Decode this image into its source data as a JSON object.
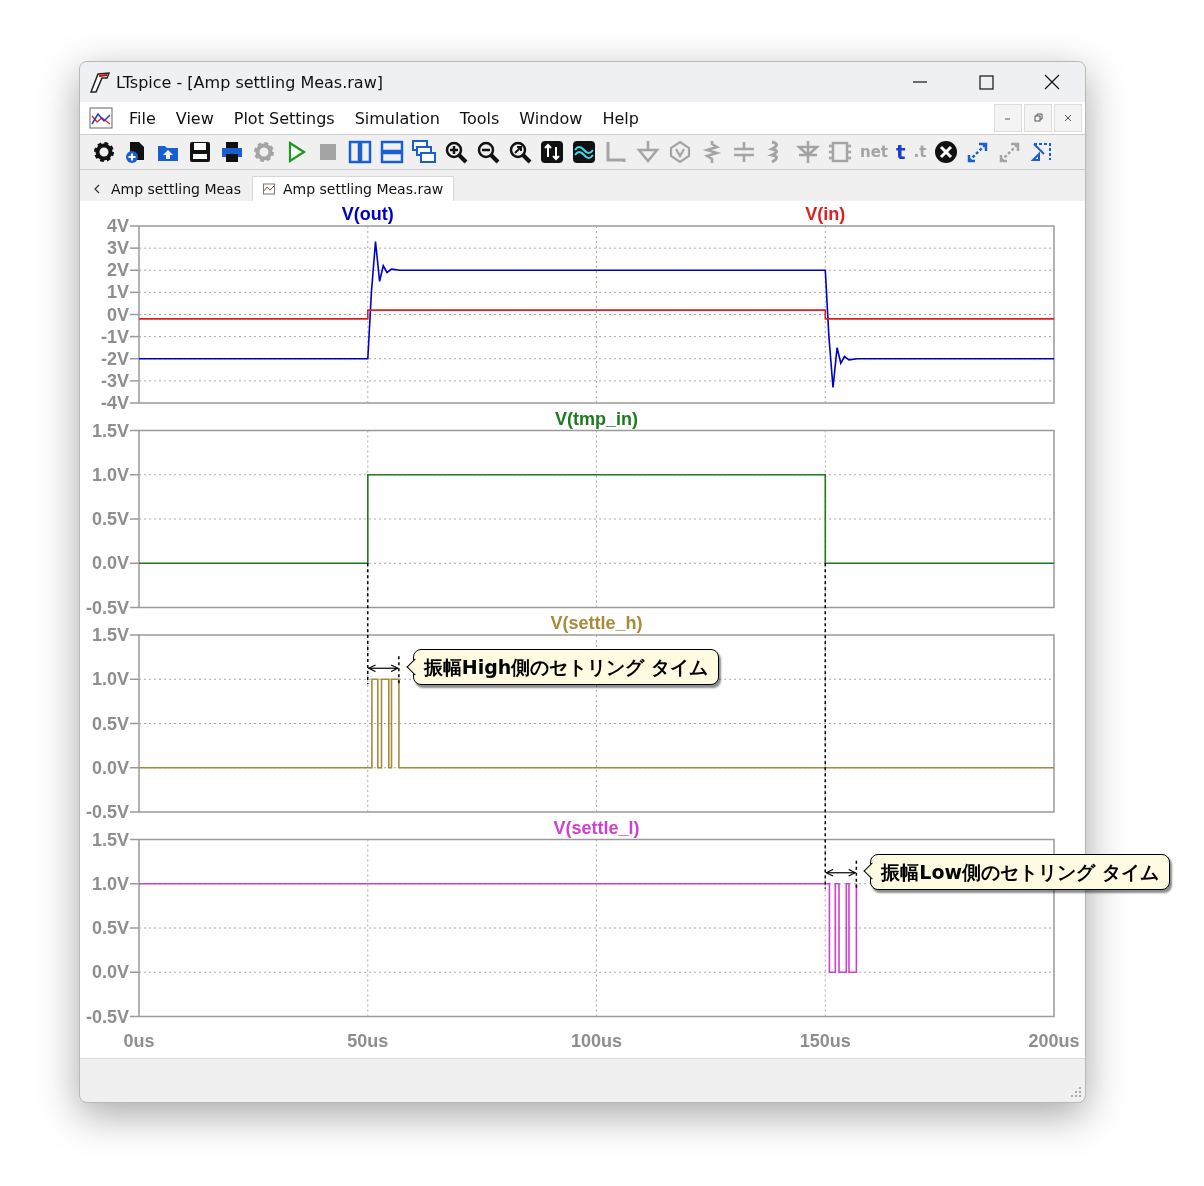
{
  "window": {
    "title": "LTspice - [Amp settling Meas.raw]"
  },
  "menu": [
    "File",
    "View",
    "Plot Settings",
    "Simulation",
    "Tools",
    "Window",
    "Help"
  ],
  "toolbar": [
    {
      "kind": "settings",
      "disabled": false
    },
    {
      "kind": "new",
      "disabled": false
    },
    {
      "kind": "open",
      "disabled": false
    },
    {
      "kind": "save",
      "disabled": false
    },
    {
      "kind": "print",
      "disabled": false
    },
    {
      "kind": "halt",
      "disabled": true
    },
    {
      "kind": "run",
      "disabled": false
    },
    {
      "kind": "stop",
      "disabled": true
    },
    {
      "kind": "tile_v",
      "disabled": false
    },
    {
      "kind": "tile_h",
      "disabled": false
    },
    {
      "kind": "cascade",
      "disabled": false
    },
    {
      "kind": "zoom_in",
      "disabled": false
    },
    {
      "kind": "zoom_out",
      "disabled": false
    },
    {
      "kind": "zoom_fit",
      "disabled": false
    },
    {
      "kind": "autorange",
      "disabled": false
    },
    {
      "kind": "wave",
      "disabled": false
    },
    {
      "kind": "wire",
      "disabled": true
    },
    {
      "kind": "ground",
      "disabled": true
    },
    {
      "kind": "node",
      "disabled": true
    },
    {
      "kind": "resistor",
      "disabled": true
    },
    {
      "kind": "capacitor",
      "disabled": true
    },
    {
      "kind": "inductor",
      "disabled": true
    },
    {
      "kind": "diode",
      "disabled": true
    },
    {
      "kind": "component",
      "disabled": true
    },
    {
      "kind": "glyph",
      "glyph": "net",
      "disabled": true
    },
    {
      "kind": "glyph",
      "glyph": "t",
      "disabled": false
    },
    {
      "kind": "glyph",
      "glyph": ".t",
      "disabled": true
    },
    {
      "kind": "delete",
      "disabled": false
    },
    {
      "kind": "duplicate",
      "disabled": false
    },
    {
      "kind": "move",
      "disabled": true
    },
    {
      "kind": "drag",
      "disabled": false
    }
  ],
  "tabs": [
    {
      "kind": "schematic",
      "label": "Amp settling Meas",
      "selected": false
    },
    {
      "kind": "waveform",
      "label": "Amp settling Meas.raw",
      "selected": true
    }
  ],
  "plot": {
    "panes": [
      {
        "chart_data": {
          "type": "line",
          "grid": true,
          "xlim": [
            0,
            200
          ],
          "ylim": [
            -4,
            4
          ],
          "x": [
            0,
            50,
            50,
            50.8,
            51.7,
            52.6,
            53.4,
            54.2,
            55.2,
            57,
            150,
            150,
            150.8,
            151.7,
            152.6,
            153.4,
            154.2,
            155.2,
            157,
            200
          ],
          "series": [
            {
              "name": "V(out)",
              "color": "#0000c8",
              "values": [
                -2,
                -2,
                -2,
                1,
                3.3,
                1.5,
                2.2,
                1.9,
                2.05,
                2,
                2,
                2,
                -1,
                -3.3,
                -1.5,
                -2.2,
                -1.9,
                -2.05,
                -2,
                -2
              ]
            },
            {
              "name": "V(in)",
              "color": "#e02020",
              "values": [
                -0.2,
                -0.2,
                0.2,
                0.2,
                0.2,
                0.2,
                0.2,
                0.2,
                0.2,
                0.2,
                0.2,
                -0.2,
                -0.2,
                -0.2,
                -0.2,
                -0.2,
                -0.2,
                -0.2,
                -0.2,
                -0.2
              ]
            }
          ],
          "yticks": [
            {
              "value": 4,
              "label": "4V"
            },
            {
              "value": 3,
              "label": "3V"
            },
            {
              "value": 2,
              "label": "2V"
            },
            {
              "value": 1,
              "label": "1V"
            },
            {
              "value": 0,
              "label": "0V"
            },
            {
              "value": -1,
              "label": "-1V"
            },
            {
              "value": -2,
              "label": "-2V"
            },
            {
              "value": -3,
              "label": "-3V"
            },
            {
              "value": -4,
              "label": "-4V"
            }
          ]
        }
      },
      {
        "chart_data": {
          "type": "line",
          "grid": true,
          "xlim": [
            0,
            200
          ],
          "ylim": [
            -0.5,
            1.5
          ],
          "x": [
            0,
            50,
            50,
            150,
            150,
            200
          ],
          "series": [
            {
              "name": "V(tmp_in)",
              "color": "#1e7a1e",
              "values": [
                0,
                0,
                1,
                1,
                0,
                0
              ]
            }
          ],
          "yticks": [
            {
              "value": 1.5,
              "label": "1.5V"
            },
            {
              "value": 1,
              "label": "1.0V"
            },
            {
              "value": 0.5,
              "label": "0.5V"
            },
            {
              "value": 0,
              "label": "0.0V"
            },
            {
              "value": -0.5,
              "label": "-0.5V"
            }
          ]
        }
      },
      {
        "chart_data": {
          "type": "line",
          "grid": true,
          "xlim": [
            0,
            200
          ],
          "ylim": [
            -0.5,
            1.5
          ],
          "x": [
            0,
            50.9,
            50.9,
            52.2,
            52.2,
            53,
            53,
            54.6,
            54.6,
            55.2,
            55.2,
            56.8,
            56.8,
            200
          ],
          "series": [
            {
              "name": "V(settle_h)",
              "color": "#a88a3c",
              "values": [
                0,
                0,
                1,
                1,
                0,
                0,
                1,
                1,
                0,
                0,
                1,
                1,
                0,
                0
              ]
            }
          ],
          "yticks": [
            {
              "value": 1.5,
              "label": "1.5V"
            },
            {
              "value": 1,
              "label": "1.0V"
            },
            {
              "value": 0.5,
              "label": "0.5V"
            },
            {
              "value": 0,
              "label": "0.0V"
            },
            {
              "value": -0.5,
              "label": "-0.5V"
            }
          ],
          "ref_lines": [
            {
              "axis": "x",
              "value": 50
            },
            {
              "axis": "x",
              "value": 56.8
            }
          ],
          "annotations": [
            {
              "text": "振幅High側のセトリング タイム"
            }
          ]
        }
      },
      {
        "chart_data": {
          "type": "line",
          "grid": true,
          "xlim": [
            0,
            200
          ],
          "ylim": [
            -0.5,
            1.5
          ],
          "x": [
            0,
            150.9,
            150.9,
            152.2,
            152.2,
            153,
            153,
            154.6,
            154.6,
            155.2,
            155.2,
            156.8,
            156.8
          ],
          "series": [
            {
              "name": "V(settle_l)",
              "color": "#d040d0",
              "values": [
                1,
                1,
                0,
                0,
                1,
                1,
                0,
                0,
                1,
                1,
                0,
                0,
                1
              ]
            }
          ],
          "yticks": [
            {
              "value": 1.5,
              "label": "1.5V"
            },
            {
              "value": 1,
              "label": "1.0V"
            },
            {
              "value": 0.5,
              "label": "0.5V"
            },
            {
              "value": 0,
              "label": "0.0V"
            },
            {
              "value": -0.5,
              "label": "-0.5V"
            }
          ],
          "xticks": [
            {
              "value": 0,
              "label": "0us"
            },
            {
              "value": 50,
              "label": "50us"
            },
            {
              "value": 100,
              "label": "100us"
            },
            {
              "value": 150,
              "label": "150us"
            },
            {
              "value": 200,
              "label": "200us"
            }
          ],
          "ref_lines": [
            {
              "axis": "x",
              "value": 150
            },
            {
              "axis": "x",
              "value": 156.8
            }
          ],
          "annotations": [
            {
              "text": "振幅Low側のセトリング タイム"
            }
          ]
        }
      }
    ]
  }
}
